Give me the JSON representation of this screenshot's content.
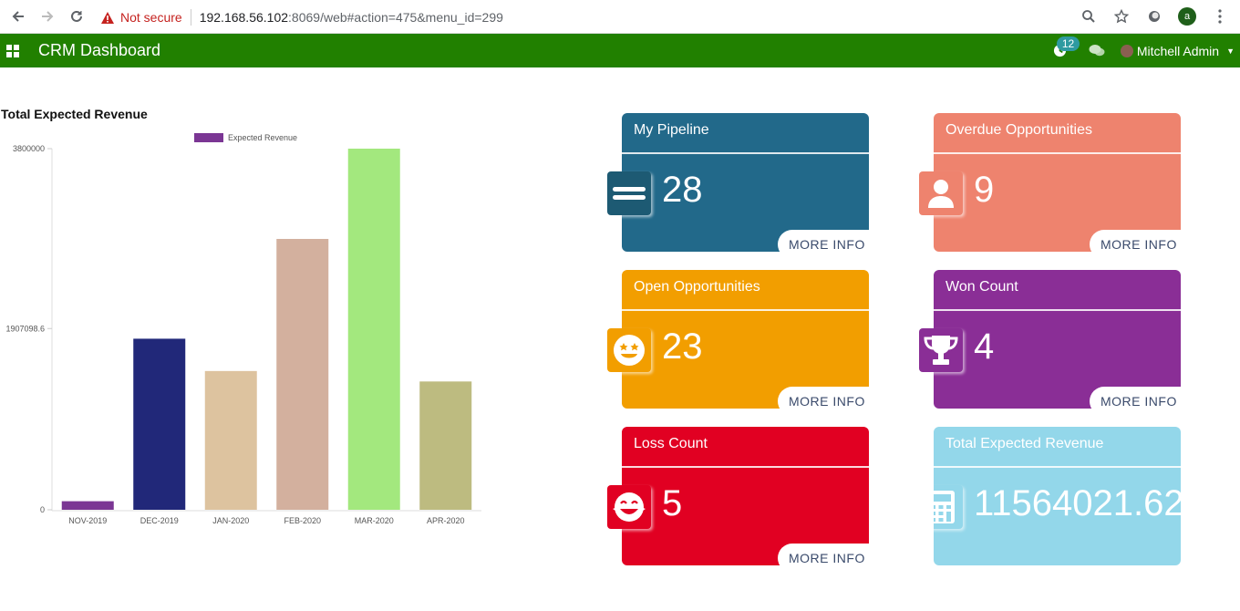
{
  "browser": {
    "security_label": "Not secure",
    "url_host": "192.168.56.102",
    "url_rest": ":8069/web#action=475&menu_id=299",
    "profile_initial": "a"
  },
  "navbar": {
    "title": "CRM Dashboard",
    "activity_count": "12",
    "user_name": "Mitchell Admin",
    "color": "#218000"
  },
  "chart_title": "Total Expected Revenue",
  "chart_data": {
    "type": "bar",
    "legend": [
      "Expected Revenue"
    ],
    "legend_placement": "top",
    "categories": [
      "NOV-2019",
      "DEC-2019",
      "JAN-2020",
      "FEB-2020",
      "MAR-2020",
      "APR-2020"
    ],
    "values": [
      90000,
      1800000,
      1460000,
      2850000,
      3800000,
      1350000
    ],
    "colors": [
      "#7b3694",
      "#212879",
      "#ddc39f",
      "#d3b09e",
      "#a3e87e",
      "#bdbb80"
    ],
    "yticks": [
      "3800000",
      "1907098.6",
      "0"
    ],
    "ylim": [
      0,
      3800000
    ],
    "grid": false
  },
  "cards": [
    {
      "title": "My Pipeline",
      "value": "28",
      "more": "MORE INFO",
      "color": "#22698a",
      "icon": "bars-icon"
    },
    {
      "title": "Overdue Opportunities",
      "value": "9",
      "more": "MORE INFO",
      "color": "#ee836e",
      "icon": "user-icon"
    },
    {
      "title": "Open Opportunities",
      "value": "23",
      "more": "MORE INFO",
      "color": "#f29e00",
      "icon": "smile-stars-icon"
    },
    {
      "title": "Won Count",
      "value": "4",
      "more": "MORE INFO",
      "color": "#8a2e96",
      "icon": "trophy-icon"
    },
    {
      "title": "Loss Count",
      "value": "5",
      "more": "MORE INFO",
      "color": "#e10022",
      "icon": "laugh-tears-icon"
    },
    {
      "title": "Total Expected Revenue",
      "value": "11564021.62",
      "color": "#93d7ea",
      "icon": "calculator-icon"
    }
  ]
}
